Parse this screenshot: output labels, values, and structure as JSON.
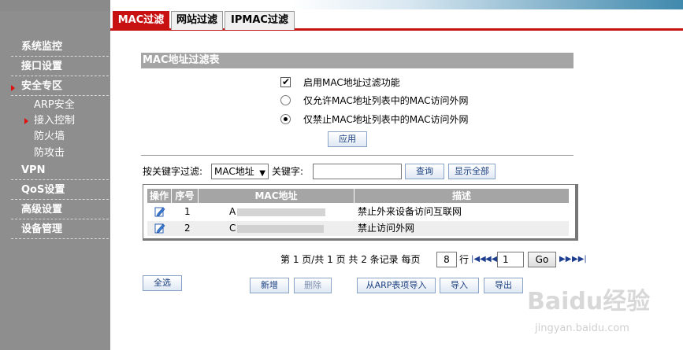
{
  "sidebar": {
    "items": [
      {
        "label": "系统监控"
      },
      {
        "label": "接口设置"
      },
      {
        "label": "安全专区"
      },
      {
        "label": "VPN"
      },
      {
        "label": "QoS设置"
      },
      {
        "label": "高级设置"
      },
      {
        "label": "设备管理"
      }
    ],
    "sub_items": [
      {
        "label": "ARP安全"
      },
      {
        "label": "接入控制"
      },
      {
        "label": "防火墙"
      },
      {
        "label": "防攻击"
      }
    ]
  },
  "tabs": [
    {
      "label": "MAC过滤"
    },
    {
      "label": "网站过滤"
    },
    {
      "label": "IPMAC过滤"
    }
  ],
  "section_title": "MAC地址过滤表",
  "options": {
    "enable_label": "启用MAC地址过滤功能",
    "allow_label": "仅允许MAC地址列表中的MAC访问外网",
    "deny_label": "仅禁止MAC地址列表中的MAC访问外网",
    "apply_label": "应用"
  },
  "filter": {
    "by_label": "按关键字过滤:",
    "field_value": "MAC地址",
    "keyword_label": "关键字:",
    "query_label": "查询",
    "show_all_label": "显示全部"
  },
  "table": {
    "headers": [
      "操作",
      "序号",
      "MAC地址",
      "描述"
    ],
    "rows": [
      {
        "index": "1",
        "mac": "A",
        "desc": "禁止外来设备访问互联网"
      },
      {
        "index": "2",
        "mac": "C",
        "desc": "禁止访问外网"
      }
    ]
  },
  "pager": {
    "summary": "第 1 页/共 1 页 共 2 条记录 每页",
    "per_page": "8",
    "row_unit": "行",
    "page": "1",
    "go_label": "Go"
  },
  "actions": {
    "select_all": "全选",
    "add": "新增",
    "delete": "删除",
    "import_arp": "从ARP表项导入",
    "import": "导入",
    "export": "导出"
  },
  "watermark": {
    "main": "Baidu经验",
    "sub": "jingyan.baidu.com"
  },
  "colors": {
    "accent_red": "#c81212",
    "sidebar_gray": "#8e8e8e",
    "header_gray": "#a5a5a5"
  }
}
